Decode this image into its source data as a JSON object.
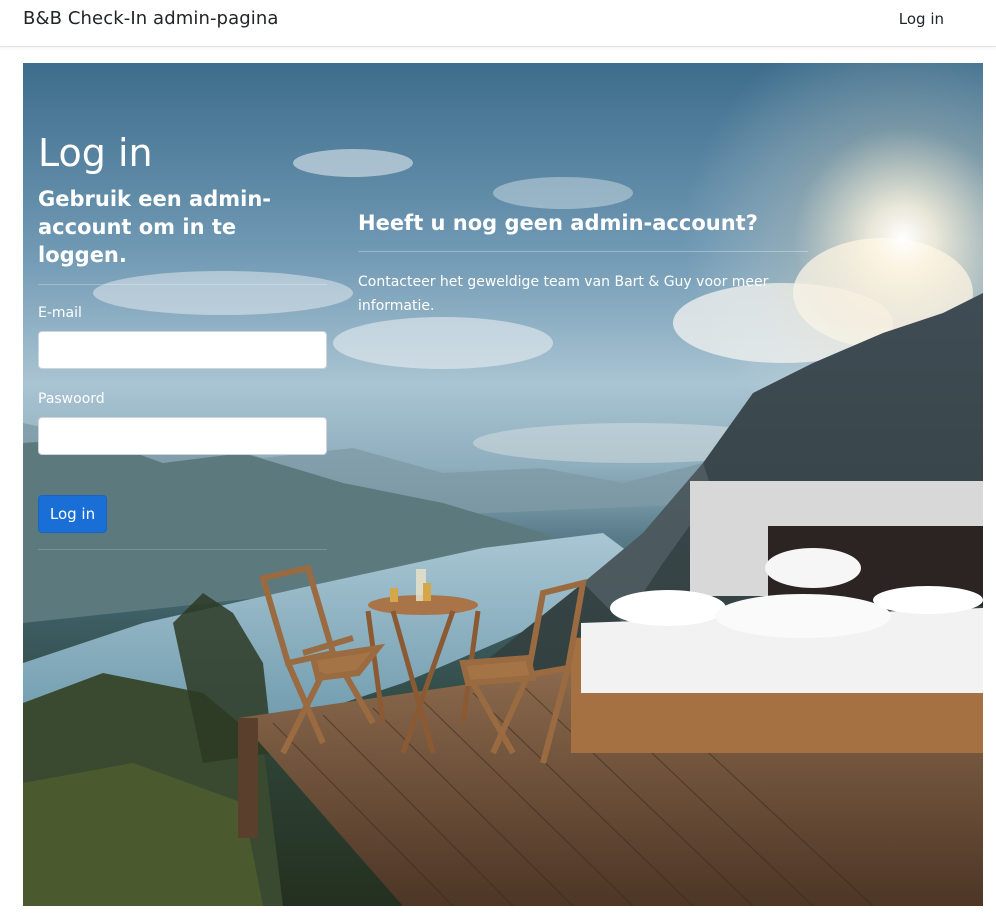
{
  "navbar": {
    "brand": "B&B Check-In admin-pagina",
    "login_link": "Log in"
  },
  "login": {
    "title": "Log in",
    "subtitle": "Gebruik een admin-account om in te loggen.",
    "email_label": "E-mail",
    "email_value": "",
    "password_label": "Paswoord",
    "password_value": "",
    "submit_label": "Log in"
  },
  "register": {
    "title": "Heeft u nog geen admin-account?",
    "text": "Contacteer het geweldige team van Bart & Guy voor meer informatie."
  },
  "colors": {
    "primary_button": "#1a6fd6",
    "text_on_image": "#ffffff"
  },
  "background_image": "mountain-lake-deck-with-bed-photo"
}
